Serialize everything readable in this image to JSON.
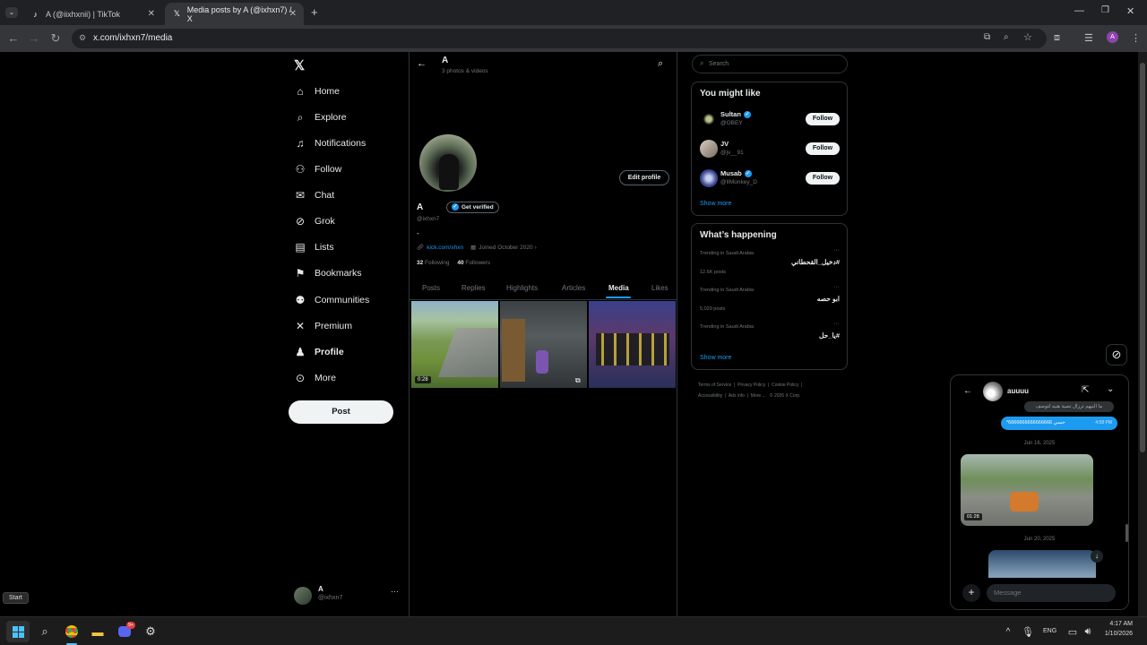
{
  "browser": {
    "tabs": [
      {
        "title": "A (@iixhxnii) | TikTok",
        "favicon": "tiktok-icon"
      },
      {
        "title": "Media posts by A (@ixhxn7) / X",
        "favicon": "x-icon"
      }
    ],
    "url": "x.com/ixhxn7/media"
  },
  "nav": {
    "items": [
      {
        "label": "Home",
        "icon": "home-icon"
      },
      {
        "label": "Explore",
        "icon": "search-icon"
      },
      {
        "label": "Notifications",
        "icon": "bell-icon"
      },
      {
        "label": "Follow",
        "icon": "add-person-icon"
      },
      {
        "label": "Chat",
        "icon": "mail-icon"
      },
      {
        "label": "Grok",
        "icon": "grok-icon"
      },
      {
        "label": "Lists",
        "icon": "list-icon"
      },
      {
        "label": "Bookmarks",
        "icon": "bookmark-icon"
      },
      {
        "label": "Communities",
        "icon": "people-icon"
      },
      {
        "label": "Premium",
        "icon": "x-icon"
      },
      {
        "label": "Profile",
        "icon": "person-icon"
      },
      {
        "label": "More",
        "icon": "more-circle-icon"
      }
    ],
    "post_label": "Post",
    "account": {
      "name": "A",
      "handle": "@ixhxn7"
    }
  },
  "profile": {
    "header_name": "A",
    "header_sub": "3 photos & videos",
    "name": "A",
    "get_verified": "Get verified",
    "handle": "@ixhxn7",
    "bio": "-",
    "link": "kick.com/xhxn",
    "joined": "Joined October 2020",
    "following_count": "32",
    "following_label": "Following",
    "followers_count": "40",
    "followers_label": "Followers",
    "edit_profile": "Edit profile",
    "tabs": [
      "Posts",
      "Replies",
      "Highlights",
      "Articles",
      "Media",
      "Likes"
    ],
    "active_tab": "Media",
    "media": [
      {
        "duration": "0:28"
      },
      {
        "duration": ""
      },
      {
        "duration": ""
      }
    ]
  },
  "sidebar": {
    "search_placeholder": "Search",
    "you_might_like": "You might like",
    "suggestions": [
      {
        "name": "Sultan",
        "handle": "@OBEY",
        "verified": true
      },
      {
        "name": "JV",
        "handle": "@jv__91",
        "verified": false
      },
      {
        "name": "Musab",
        "handle": "@lIMonkey_D",
        "verified": true
      }
    ],
    "follow_label": "Follow",
    "show_more": "Show more",
    "whats_happening": "What’s happening",
    "trends": [
      {
        "context": "Trending in Saudi Arabia",
        "topic": "#دخيل_القحطاني",
        "posts": "12.6K posts"
      },
      {
        "context": "Trending in Saudi Arabia",
        "topic": "ابو حصه",
        "posts": "5,029 posts"
      },
      {
        "context": "Trending in Saudi Arabia",
        "topic": "#يا_حل",
        "posts": ""
      }
    ],
    "show_more_2": "Show more",
    "footer": [
      "Terms of Service",
      "Privacy Policy",
      "Cookie Policy",
      "Accessibility",
      "Ads info",
      "More ...",
      "© 2026 X Corp."
    ]
  },
  "chat": {
    "name": "auuuu",
    "msg_above": "ما النيهم ترزال تصية هنيه لتوصف",
    "msg_sent": "*6666666666666666 حسي",
    "msg_time": "4:58 PM",
    "date1": "Jun 16, 2025",
    "video1_duration": "01:28",
    "date2": "Jun 20, 2025",
    "message_placeholder": "Message"
  },
  "taskbar": {
    "start_tooltip": "Start",
    "lang": "ENG",
    "time": "4:17 AM",
    "date": "1/10/2026",
    "discord_badge": "9+"
  }
}
